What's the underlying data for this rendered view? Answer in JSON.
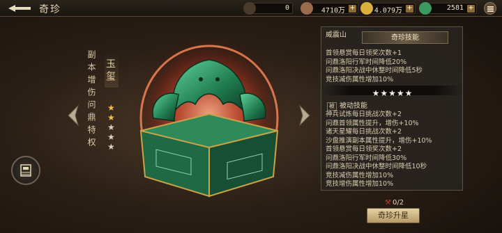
{
  "header": {
    "title": "奇珍",
    "resources": [
      {
        "icon": "hammer-icon",
        "value": "0"
      },
      {
        "icon": "sack-icon",
        "value": "4710万"
      },
      {
        "icon": "coin-icon",
        "value": "4.079万"
      },
      {
        "icon": "jade-icon",
        "value": "2581"
      }
    ],
    "plus": "+"
  },
  "treasure": {
    "name": "玉玺",
    "property_label": "副本增伤问鼎特权",
    "stars_total": 5,
    "stars_lit": 2
  },
  "panel": {
    "tab": "威震山",
    "header": "奇珍技能",
    "lines_top": [
      "首领悬赏每日领奖次数+1",
      "问鼎洛阳行军时间降低20%",
      "问鼎洛阳决战中休整时间降低5秒",
      "竞技减伤属性增加10%"
    ],
    "stars": "★★★★★",
    "section_badge": "被",
    "section_title": "被动技能",
    "lines_bottom": [
      "神兵试炼每日挑战次数+2",
      "问鼎首领属性提升，增伤+10%",
      "诸天星耀每日挑战次数+2",
      "沙盘推演副本属性提升，增伤+10%",
      "首领悬赏每日领奖次数+2",
      "问鼎洛阳行军时间降低30%",
      "问鼎洛阳决战中休整时间降低10秒",
      "竞技减伤属性增加10%",
      "竞技增伤属性增加10%"
    ]
  },
  "bottom": {
    "progress": "0/2",
    "upgrade_label": "奇珍升星"
  },
  "colors": {
    "accent_gold": "#f2c24a",
    "jade": "#2f8a5a",
    "glow": "#e0442a"
  }
}
